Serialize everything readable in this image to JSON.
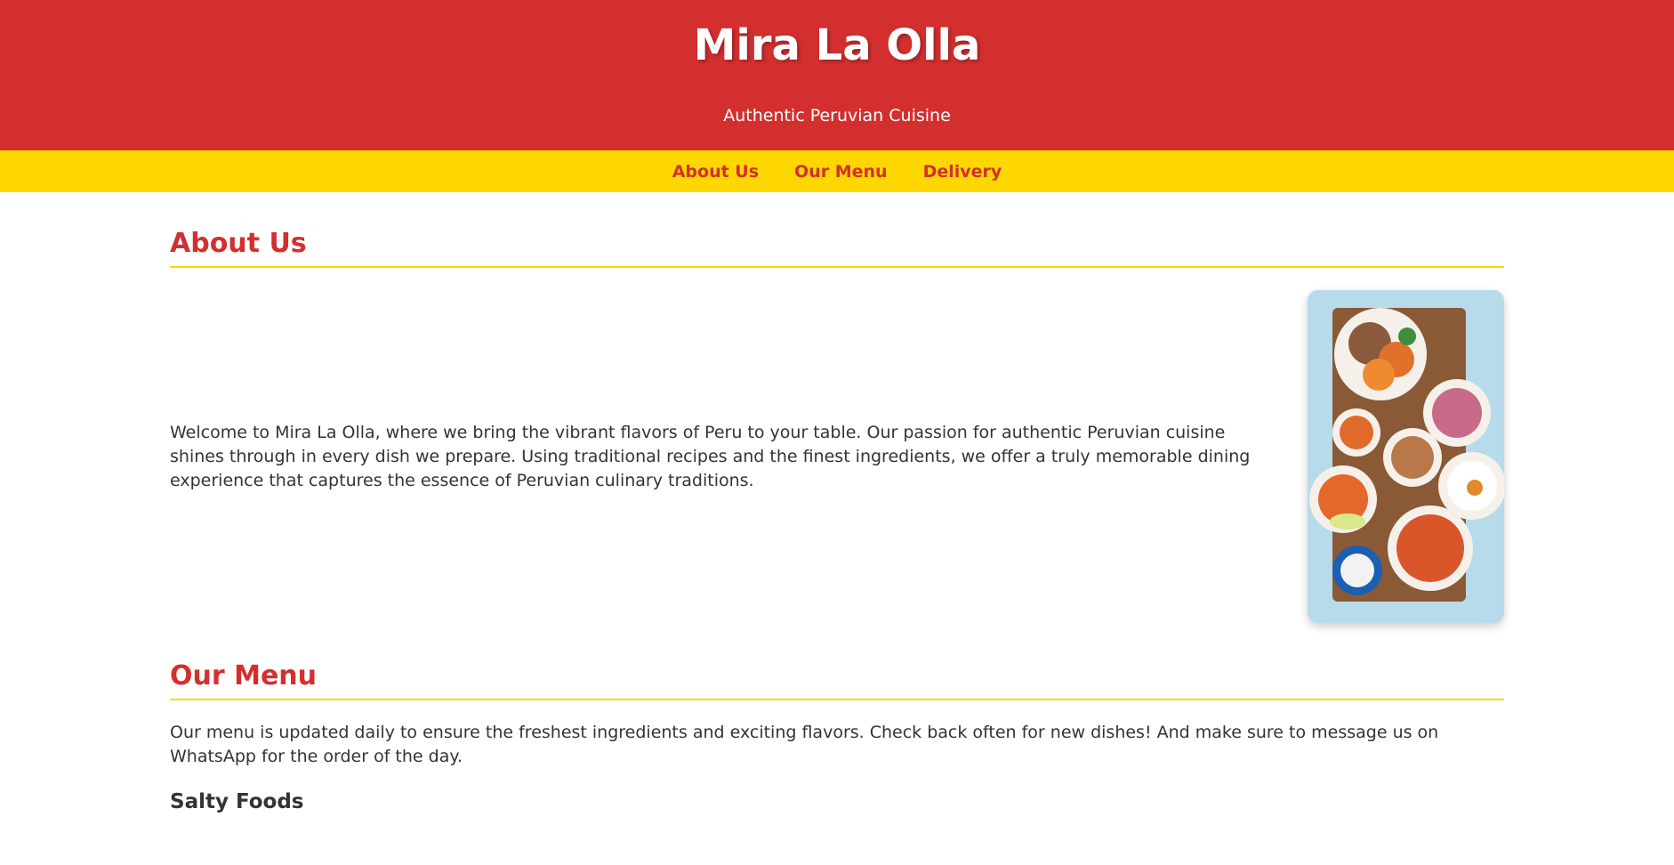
{
  "header": {
    "title": "Mira La Olla",
    "tagline": "Authentic Peruvian Cuisine"
  },
  "nav": {
    "items": [
      {
        "label": "About Us"
      },
      {
        "label": "Our Menu"
      },
      {
        "label": "Delivery"
      }
    ]
  },
  "about": {
    "title": "About Us",
    "text": "Welcome to Mira La Olla, where we bring the vibrant flavors of Peru to your table. Our passion for authentic Peruvian cuisine shines through in every dish we prepare. Using traditional recipes and the finest ingredients, we offer a truly memorable dining experience that captures the essence of Peruvian culinary traditions."
  },
  "menu": {
    "title": "Our Menu",
    "text": "Our menu is updated daily to ensure the freshest ingredients and exciting flavors. Check back often for new dishes! And make sure to message us on WhatsApp for the order of the day.",
    "subsection": "Salty Foods"
  },
  "colors": {
    "primary": "#d32f2f",
    "accent": "#ffd700",
    "text": "#333333"
  }
}
